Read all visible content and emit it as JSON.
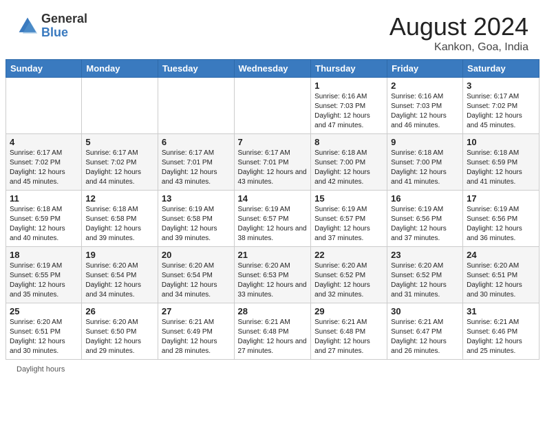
{
  "header": {
    "logo_general": "General",
    "logo_blue": "Blue",
    "month_year": "August 2024",
    "location": "Kankon, Goa, India"
  },
  "days_of_week": [
    "Sunday",
    "Monday",
    "Tuesday",
    "Wednesday",
    "Thursday",
    "Friday",
    "Saturday"
  ],
  "weeks": [
    [
      null,
      null,
      null,
      null,
      {
        "day": 1,
        "sunrise": "6:16 AM",
        "sunset": "7:03 PM",
        "hours": "12 hours and 47 minutes."
      },
      {
        "day": 2,
        "sunrise": "6:16 AM",
        "sunset": "7:03 PM",
        "hours": "12 hours and 46 minutes."
      },
      {
        "day": 3,
        "sunrise": "6:17 AM",
        "sunset": "7:02 PM",
        "hours": "12 hours and 45 minutes."
      }
    ],
    [
      {
        "day": 4,
        "sunrise": "6:17 AM",
        "sunset": "7:02 PM",
        "hours": "12 hours and 45 minutes."
      },
      {
        "day": 5,
        "sunrise": "6:17 AM",
        "sunset": "7:02 PM",
        "hours": "12 hours and 44 minutes."
      },
      {
        "day": 6,
        "sunrise": "6:17 AM",
        "sunset": "7:01 PM",
        "hours": "12 hours and 43 minutes."
      },
      {
        "day": 7,
        "sunrise": "6:17 AM",
        "sunset": "7:01 PM",
        "hours": "12 hours and 43 minutes."
      },
      {
        "day": 8,
        "sunrise": "6:18 AM",
        "sunset": "7:00 PM",
        "hours": "12 hours and 42 minutes."
      },
      {
        "day": 9,
        "sunrise": "6:18 AM",
        "sunset": "7:00 PM",
        "hours": "12 hours and 41 minutes."
      },
      {
        "day": 10,
        "sunrise": "6:18 AM",
        "sunset": "6:59 PM",
        "hours": "12 hours and 41 minutes."
      }
    ],
    [
      {
        "day": 11,
        "sunrise": "6:18 AM",
        "sunset": "6:59 PM",
        "hours": "12 hours and 40 minutes."
      },
      {
        "day": 12,
        "sunrise": "6:18 AM",
        "sunset": "6:58 PM",
        "hours": "12 hours and 39 minutes."
      },
      {
        "day": 13,
        "sunrise": "6:19 AM",
        "sunset": "6:58 PM",
        "hours": "12 hours and 39 minutes."
      },
      {
        "day": 14,
        "sunrise": "6:19 AM",
        "sunset": "6:57 PM",
        "hours": "12 hours and 38 minutes."
      },
      {
        "day": 15,
        "sunrise": "6:19 AM",
        "sunset": "6:57 PM",
        "hours": "12 hours and 37 minutes."
      },
      {
        "day": 16,
        "sunrise": "6:19 AM",
        "sunset": "6:56 PM",
        "hours": "12 hours and 37 minutes."
      },
      {
        "day": 17,
        "sunrise": "6:19 AM",
        "sunset": "6:56 PM",
        "hours": "12 hours and 36 minutes."
      }
    ],
    [
      {
        "day": 18,
        "sunrise": "6:19 AM",
        "sunset": "6:55 PM",
        "hours": "12 hours and 35 minutes."
      },
      {
        "day": 19,
        "sunrise": "6:20 AM",
        "sunset": "6:54 PM",
        "hours": "12 hours and 34 minutes."
      },
      {
        "day": 20,
        "sunrise": "6:20 AM",
        "sunset": "6:54 PM",
        "hours": "12 hours and 34 minutes."
      },
      {
        "day": 21,
        "sunrise": "6:20 AM",
        "sunset": "6:53 PM",
        "hours": "12 hours and 33 minutes."
      },
      {
        "day": 22,
        "sunrise": "6:20 AM",
        "sunset": "6:52 PM",
        "hours": "12 hours and 32 minutes."
      },
      {
        "day": 23,
        "sunrise": "6:20 AM",
        "sunset": "6:52 PM",
        "hours": "12 hours and 31 minutes."
      },
      {
        "day": 24,
        "sunrise": "6:20 AM",
        "sunset": "6:51 PM",
        "hours": "12 hours and 30 minutes."
      }
    ],
    [
      {
        "day": 25,
        "sunrise": "6:20 AM",
        "sunset": "6:51 PM",
        "hours": "12 hours and 30 minutes."
      },
      {
        "day": 26,
        "sunrise": "6:20 AM",
        "sunset": "6:50 PM",
        "hours": "12 hours and 29 minutes."
      },
      {
        "day": 27,
        "sunrise": "6:21 AM",
        "sunset": "6:49 PM",
        "hours": "12 hours and 28 minutes."
      },
      {
        "day": 28,
        "sunrise": "6:21 AM",
        "sunset": "6:48 PM",
        "hours": "12 hours and 27 minutes."
      },
      {
        "day": 29,
        "sunrise": "6:21 AM",
        "sunset": "6:48 PM",
        "hours": "12 hours and 27 minutes."
      },
      {
        "day": 30,
        "sunrise": "6:21 AM",
        "sunset": "6:47 PM",
        "hours": "12 hours and 26 minutes."
      },
      {
        "day": 31,
        "sunrise": "6:21 AM",
        "sunset": "6:46 PM",
        "hours": "12 hours and 25 minutes."
      }
    ]
  ],
  "footer": {
    "note": "Daylight hours"
  }
}
